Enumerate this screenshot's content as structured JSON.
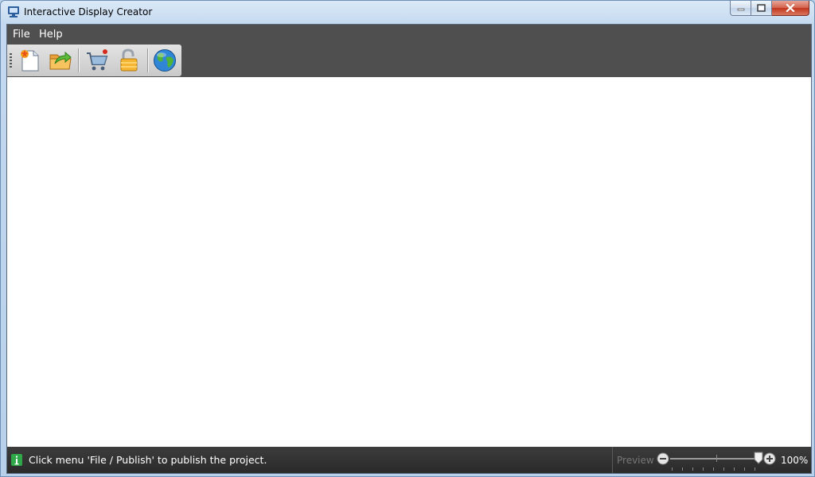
{
  "window": {
    "title": "Interactive Display Creator",
    "app_icon": "monitor-icon",
    "caption_buttons": [
      "minimize-icon",
      "maximize-icon",
      "close-icon"
    ]
  },
  "menubar": {
    "items": [
      {
        "label": "File"
      },
      {
        "label": "Help"
      }
    ]
  },
  "toolbar": {
    "buttons": [
      {
        "icon": "new-document-icon"
      },
      {
        "icon": "open-folder-icon"
      },
      {
        "icon": "shopping-cart-icon"
      },
      {
        "icon": "unlock-icon"
      },
      {
        "icon": "globe-icon"
      }
    ]
  },
  "statusbar": {
    "info_icon": "info-icon",
    "message": "Click menu 'File / Publish' to publish the project.",
    "preview_label": "Preview",
    "zoom_value": "100%",
    "zoom_fraction": 1.0
  },
  "colors": {
    "menubar_bg": "#4f4f4f",
    "statusbar_bg": "#333333",
    "info_icon_green": "#2fa84a",
    "close_red": "#c9452c"
  }
}
